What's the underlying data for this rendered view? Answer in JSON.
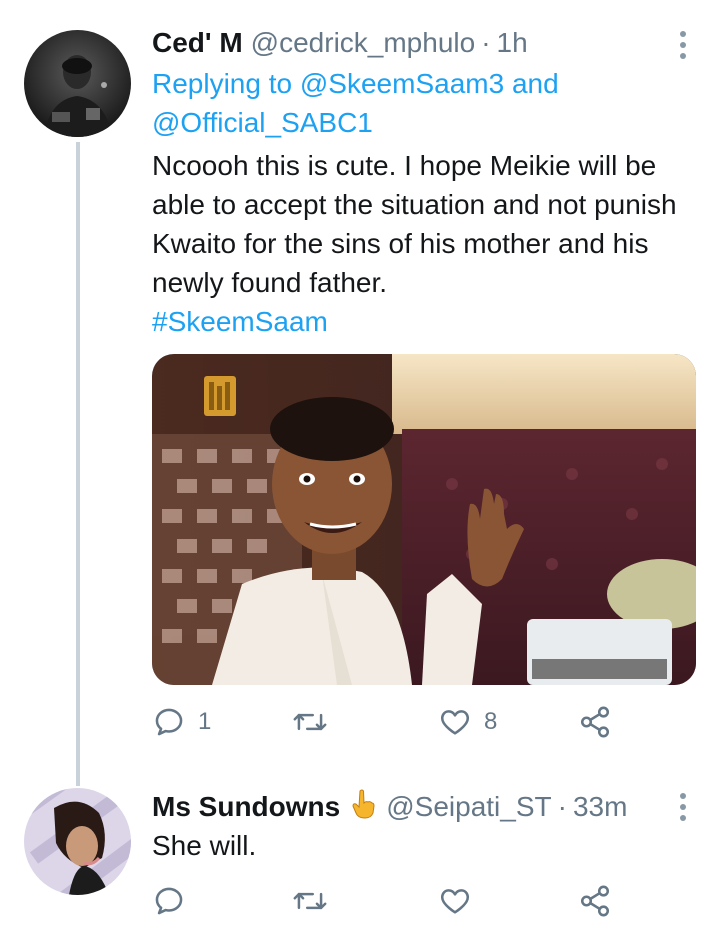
{
  "tweet1": {
    "name": "Ced' M",
    "handle": "@cedrick_mphulo",
    "separator": "·",
    "time": "1h",
    "replying_prefix": "Replying to",
    "replying_to_1": "@SkeemSaam3",
    "replying_and": "and",
    "replying_to_2": "@Official_SABC1",
    "text": "Ncoooh this is cute. I hope Meikie will be able to accept the situation and not punish Kwaito for the sins of his mother and his newly found father.",
    "hashtag": "#SkeemSaam",
    "reply_count": "1",
    "retweet_count": "",
    "like_count": "8"
  },
  "tweet2": {
    "name": "Ms Sundowns",
    "handle": "@Seipati_ST",
    "separator": "·",
    "time": "33m",
    "text": "She will.",
    "reply_count": "",
    "retweet_count": "",
    "like_count": ""
  },
  "icons": {
    "reply": "reply-icon",
    "retweet": "retweet-icon",
    "like": "heart-icon",
    "share": "share-icon",
    "more": "more-vertical-icon",
    "emoji": "pointing-hand-emoji"
  },
  "colors": {
    "link": "#1da1f2",
    "secondary": "#657786",
    "text": "#14171a",
    "thread_line": "#c9d1d9"
  }
}
